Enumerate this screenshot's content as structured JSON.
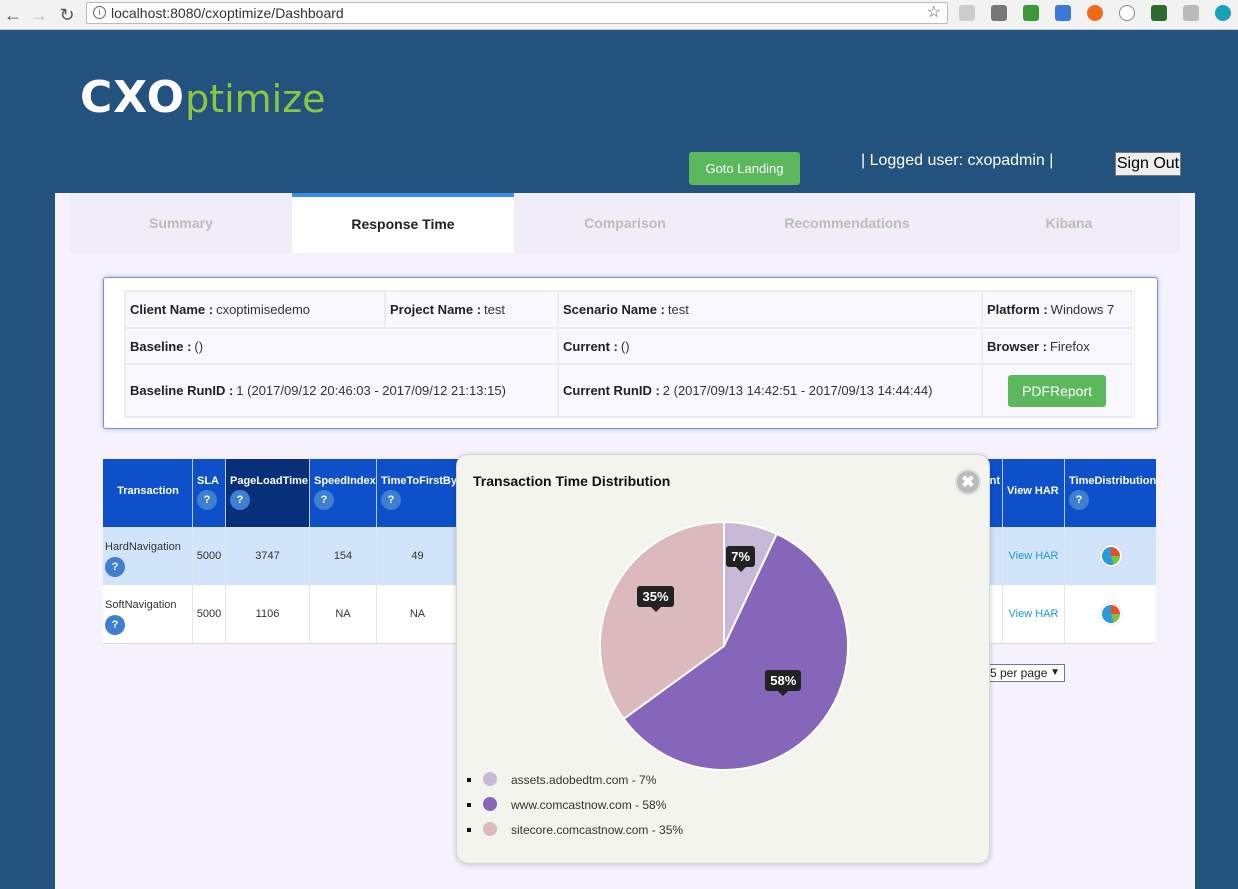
{
  "browser": {
    "url": "localhost:8080/cxoptimize/Dashboard"
  },
  "header": {
    "logo_bold": "CXO",
    "logo_light": "ptimize",
    "goto_label": "Goto Landing",
    "user_text": "| Logged user: cxopadmin |",
    "signout_label": "Sign Out"
  },
  "tabs": [
    {
      "label": "Summary"
    },
    {
      "label": "Response Time"
    },
    {
      "label": "Comparison"
    },
    {
      "label": "Recommendations"
    },
    {
      "label": "Kibana"
    }
  ],
  "info": {
    "client_label": "Client Name :",
    "client_value": "cxoptimisedemo",
    "project_label": "Project Name :",
    "project_value": "test",
    "scenario_label": "Scenario Name :",
    "scenario_value": "test",
    "platform_label": "Platform :",
    "platform_value": "Windows 7",
    "baseline_label": "Baseline :",
    "baseline_value": "()",
    "current_label": "Current :",
    "current_value": "()",
    "browser_label": "Browser :",
    "browser_value": "Firefox",
    "baseline_run_label": "Baseline RunID :",
    "baseline_run_value": "1 (2017/09/12 20:46:03 - 2017/09/12 21:13:15)",
    "current_run_label": "Current RunID :",
    "current_run_value": "2 (2017/09/13 14:42:51 - 2017/09/13 14:44:44)",
    "pdf_label": "PDFReport"
  },
  "table": {
    "headers": {
      "transaction": "Transaction",
      "sla": "SLA",
      "pageload": "PageLoadTime",
      "speedindex": "SpeedIndex",
      "ttfb": "TimeToFirstByt",
      "hidden_tail": "nt",
      "viewhar": "View HAR",
      "timedist": "TimeDistribution"
    },
    "help_glyph": "?",
    "rows": [
      {
        "transaction": "HardNavigation",
        "sla": "5000",
        "pageload": "3747",
        "speedindex": "154",
        "ttfb": "49",
        "viewhar": "View HAR"
      },
      {
        "transaction": "SoftNavigation",
        "sla": "5000",
        "pageload": "1106",
        "speedindex": "NA",
        "ttfb": "NA",
        "viewhar": "View HAR"
      }
    ],
    "per_page": "5 per page"
  },
  "popup": {
    "title": "Transaction Time Distribution",
    "close_glyph": "✖",
    "legend": [
      {
        "label": "assets.adobedtm.com - 7%"
      },
      {
        "label": "www.comcastnow.com - 58%"
      },
      {
        "label": "sitecore.comcastnow.com - 35%"
      }
    ]
  },
  "chart_data": {
    "type": "pie",
    "title": "Transaction Time Distribution",
    "categories": [
      "assets.adobedtm.com",
      "www.comcastnow.com",
      "sitecore.comcastnow.com"
    ],
    "values": [
      7,
      58,
      35
    ],
    "labels": [
      "7%",
      "58%",
      "35%"
    ],
    "colors": [
      "#c8b8d8",
      "#8566b9",
      "#dbb9bd"
    ],
    "legend": "bottom-left"
  }
}
